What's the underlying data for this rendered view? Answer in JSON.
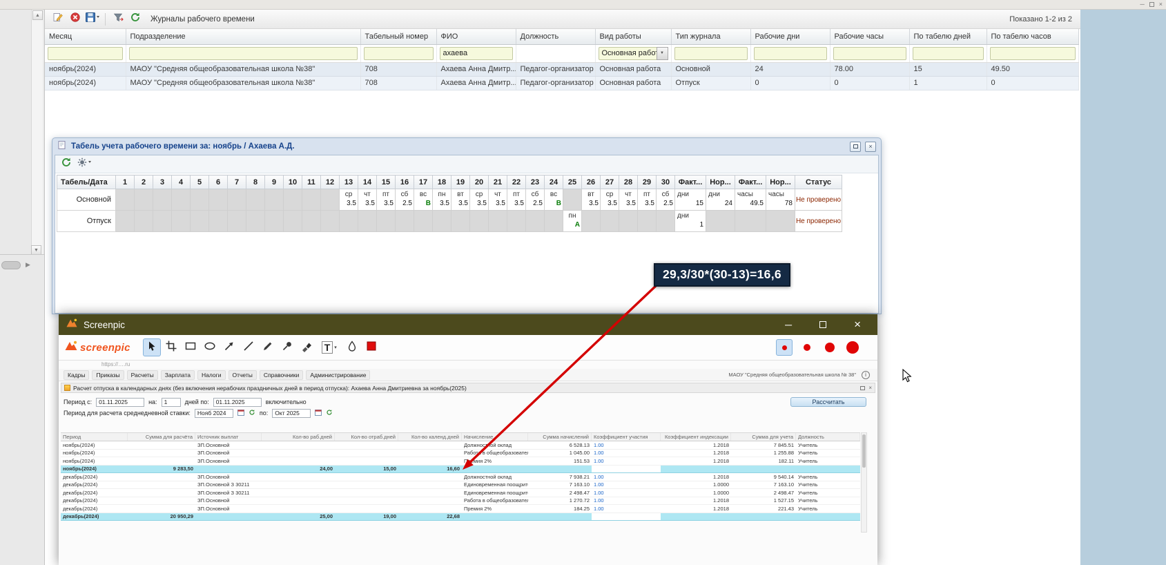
{
  "os": {
    "minimize": "─",
    "close": "×"
  },
  "journal": {
    "toolbar_title": "Журналы рабочего времени",
    "shown": "Показано 1-2 из 2",
    "toolbar_icons": [
      "edit-icon",
      "delete-icon",
      "save-icon",
      "separator",
      "filter-icon",
      "refresh-icon"
    ],
    "columns": [
      "Месяц",
      "Подразделение",
      "Табельный номер",
      "ФИО",
      "Должность",
      "Вид работы",
      "Тип журнала",
      "Рабочие дни",
      "Рабочие часы",
      "По табелю дней",
      "По табелю часов"
    ],
    "filters": [
      {
        "type": "input"
      },
      {
        "type": "input"
      },
      {
        "type": "input"
      },
      {
        "type": "input",
        "value": "ахаева"
      },
      {
        "type": "none"
      },
      {
        "type": "combo",
        "value": "Основная работ"
      },
      {
        "type": "input"
      },
      {
        "type": "input"
      },
      {
        "type": "input"
      },
      {
        "type": "input"
      },
      {
        "type": "input"
      }
    ],
    "rows": [
      [
        "ноябрь(2024)",
        "МАОУ \"Средняя общеобразовательная школа №38\"",
        "708",
        "Ахаева Анна Дмитр...",
        "Педагог-организатор",
        "Основная работа",
        "Основной",
        "24",
        "78.00",
        "15",
        "49.50"
      ],
      [
        "ноябрь(2024)",
        "МАОУ \"Средняя общеобразовательная школа №38\"",
        "708",
        "Ахаева Анна Дмитр...",
        "Педагог-организатор",
        "Основная работа",
        "Отпуск",
        "0",
        "0",
        "1",
        "0"
      ]
    ]
  },
  "timesheet": {
    "title": "Табель учета рабочего времени за: ноябрь / Ахаева А.Д.",
    "toolbar_icons": [
      "refresh-icon",
      "settings-icon"
    ],
    "first_col": "Табель/Дата",
    "day_numbers": [
      "1",
      "2",
      "3",
      "4",
      "5",
      "6",
      "7",
      "8",
      "9",
      "10",
      "11",
      "12",
      "13",
      "14",
      "15",
      "16",
      "17",
      "18",
      "19",
      "20",
      "21",
      "22",
      "23",
      "24",
      "25",
      "26",
      "27",
      "28",
      "29",
      "30"
    ],
    "summary_headers": [
      "Факт...",
      "Нор...",
      "Факт...",
      "Нор...",
      "Статус"
    ],
    "rows": [
      {
        "label": "Основной",
        "days": {
          "13": [
            "ср",
            "3.5"
          ],
          "14": [
            "чт",
            "3.5"
          ],
          "15": [
            "пт",
            "3.5"
          ],
          "16": [
            "сб",
            "2.5"
          ],
          "17": [
            "вс",
            "В"
          ],
          "18": [
            "пн",
            "3.5"
          ],
          "19": [
            "вт",
            "3.5"
          ],
          "20": [
            "ср",
            "3.5"
          ],
          "21": [
            "чт",
            "3.5"
          ],
          "22": [
            "пт",
            "3.5"
          ],
          "23": [
            "сб",
            "2.5"
          ],
          "24": [
            "вс",
            "В"
          ],
          "26": [
            "вт",
            "3.5"
          ],
          "27": [
            "ср",
            "3.5"
          ],
          "28": [
            "чт",
            "3.5"
          ],
          "29": [
            "пт",
            "3.5"
          ],
          "30": [
            "сб",
            "2.5"
          ]
        },
        "green_days": [
          "17",
          "24"
        ],
        "summary": [
          [
            "дни",
            "15"
          ],
          [
            "дни",
            "24"
          ],
          [
            "часы",
            "49.5"
          ],
          [
            "часы",
            "78"
          ]
        ],
        "status": "Не проверено"
      },
      {
        "label": "Отпуск",
        "days": {
          "25": [
            "пн",
            "А"
          ]
        },
        "green_days": [
          "25"
        ],
        "summary": [
          [
            "дни",
            "1"
          ],
          null,
          null,
          null
        ],
        "status": "Не проверено"
      }
    ]
  },
  "annotation": {
    "formula": "29,3/30*(30-13)=16,6"
  },
  "screenpic": {
    "window_title": "Screenpic",
    "logo_text": "screenpic",
    "text_tool_label": "T",
    "tools": [
      {
        "name": "cursor-tool",
        "selected": true
      },
      {
        "name": "crop-tool"
      },
      {
        "name": "rectangle-tool"
      },
      {
        "name": "ellipse-tool"
      },
      {
        "name": "arrow-tool"
      },
      {
        "name": "line-tool"
      },
      {
        "name": "pencil-tool"
      },
      {
        "name": "pin-tool"
      },
      {
        "name": "marker-tool"
      },
      {
        "name": "text-tool"
      },
      {
        "name": "blur-tool"
      },
      {
        "name": "color-swatch"
      }
    ],
    "sizes": [
      {
        "d": 7,
        "selected": true
      },
      {
        "d": 10
      },
      {
        "d": 14
      },
      {
        "d": 18
      }
    ]
  },
  "capture": {
    "url_hint": "https://….ru",
    "menu": [
      "Кадры",
      "Приказы",
      "Расчеты",
      "Зарплата",
      "Налоги",
      "Отчеты",
      "Справочники",
      "Администрирование"
    ],
    "org": "МАОУ \"Средняя общеобразовательная школа № 38\"",
    "doc_title": "Расчет отпуска в календарных днях (без включения нерабочих праздничных дней в период отпуска): Ахаева Анна Дмитриевна за ноябрь(2025)",
    "form": {
      "period_label": "Период с:",
      "period_from": "01.11.2025",
      "na_label": "на:",
      "na_value": "1",
      "days_label": "дней по:",
      "period_to": "01.11.2025",
      "inclusive_label": "включительно",
      "avg_label": "Период для расчета среднедневной ставки:",
      "avg_from": "Нояб 2024",
      "po_label": "по:",
      "avg_to": "Окт 2025",
      "calc_button": "Рассчитать"
    },
    "table": {
      "columns": [
        "Период",
        "Сумма для расчёта",
        "Источник выплат",
        "Кол-во раб.дней",
        "Кол-во отраб.дней",
        "Кол-во календ.дней",
        "Начисление",
        "Сумма начислений",
        "Коэффициент участия",
        "Коэффициент индексации",
        "Сумма для учета",
        "Должность"
      ],
      "rows": [
        {
          "total": false,
          "cells": [
            "ноябрь(2024)",
            "",
            "ЗП.Основной",
            "",
            "",
            "",
            "Должностной оклад",
            "6 528.13",
            "1.00",
            "1.2018",
            "7 845.51",
            "Учитель"
          ]
        },
        {
          "total": false,
          "cells": [
            "ноябрь(2024)",
            "",
            "ЗП.Основной",
            "",
            "",
            "",
            "Работа в общеобразовательн...",
            "1 045.00",
            "1.00",
            "1.2018",
            "1 255.88",
            "Учитель"
          ]
        },
        {
          "total": false,
          "cells": [
            "ноябрь(2024)",
            "",
            "ЗП.Основной",
            "",
            "",
            "",
            "Премия 2%",
            "151.53",
            "1.00",
            "1.2018",
            "182.11",
            "Учитель"
          ]
        },
        {
          "total": true,
          "cells": [
            "ноябрь(2024)",
            "9 283,50",
            "",
            "24,00",
            "15,00",
            "16,60",
            "",
            "",
            "",
            "",
            "",
            ""
          ]
        },
        {
          "total": false,
          "cells": [
            "декабрь(2024)",
            "",
            "ЗП.Основной",
            "",
            "",
            "",
            "Должностной оклад",
            "7 938.21",
            "1.00",
            "1.2018",
            "9 540.14",
            "Учитель"
          ]
        },
        {
          "total": false,
          "cells": [
            "декабрь(2024)",
            "",
            "ЗП.Основной З 30211",
            "",
            "",
            "",
            "Единовременная поощритель...",
            "7 163.10",
            "1.00",
            "1.0000",
            "7 163.10",
            "Учитель"
          ]
        },
        {
          "total": false,
          "cells": [
            "декабрь(2024)",
            "",
            "ЗП.Основной З 30211",
            "",
            "",
            "",
            "Единовременная поощритель...",
            "2 498.47",
            "1.00",
            "1.0000",
            "2 498.47",
            "Учитель"
          ]
        },
        {
          "total": false,
          "cells": [
            "декабрь(2024)",
            "",
            "ЗП.Основной",
            "",
            "",
            "",
            "Работа в общеобразовательн...",
            "1 270.72",
            "1.00",
            "1.2018",
            "1 527.15",
            "Учитель"
          ]
        },
        {
          "total": false,
          "cells": [
            "декабрь(2024)",
            "",
            "ЗП.Основной",
            "",
            "",
            "",
            "Премия 2%",
            "184.25",
            "1.00",
            "1.2018",
            "221.43",
            "Учитель"
          ]
        },
        {
          "total": true,
          "cells": [
            "декабрь(2024)",
            "20 950,29",
            "",
            "25,00",
            "19,00",
            "22,68",
            "",
            "",
            "",
            "",
            "",
            ""
          ]
        }
      ]
    }
  }
}
